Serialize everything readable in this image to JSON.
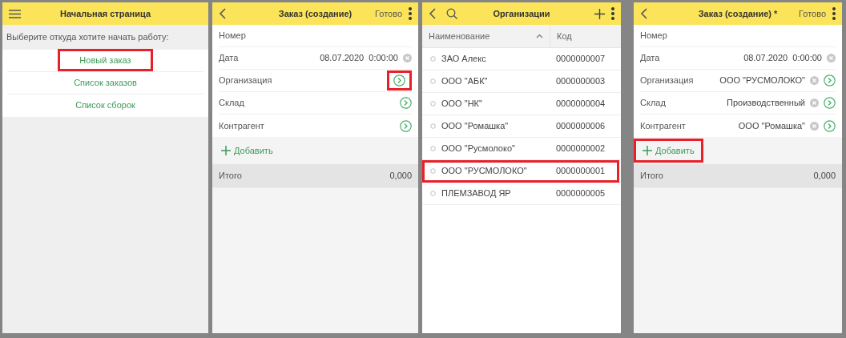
{
  "screens": [
    {
      "kind": "home",
      "title": "Начальная страница",
      "prompt": "Выберите откуда хотите начать работу:",
      "links": [
        {
          "label": "Новый заказ",
          "highlighted": true
        },
        {
          "label": "Список заказов",
          "highlighted": false
        },
        {
          "label": "Список сборок",
          "highlighted": false
        }
      ]
    },
    {
      "kind": "form",
      "title": "Заказ (создание)",
      "done": "Готово",
      "fields": [
        {
          "label": "Номер",
          "clear": false,
          "select": false,
          "highlighted": false
        },
        {
          "label": "Дата",
          "value": "08.07.2020  0:00:00",
          "clear": true,
          "select": false,
          "highlighted": false
        },
        {
          "label": "Организация",
          "clear": false,
          "select": true,
          "highlighted": true
        },
        {
          "label": "Склад",
          "clear": false,
          "select": true,
          "highlighted": false
        },
        {
          "label": "Контрагент",
          "clear": false,
          "select": true,
          "highlighted": false
        }
      ],
      "add": {
        "label": "Добавить",
        "highlighted": false
      },
      "total": {
        "label": "Итого",
        "value": "0,000"
      }
    },
    {
      "kind": "list",
      "title": "Организации",
      "columns": [
        {
          "label": "Наименование",
          "sorted": true
        },
        {
          "label": "Код",
          "sorted": false
        }
      ],
      "rows": [
        {
          "name": "ЗАО Алекс",
          "code": "0000000007",
          "highlighted": false
        },
        {
          "name": "ООО \"АБК\"",
          "code": "0000000003",
          "highlighted": false
        },
        {
          "name": "ООО \"НК\"",
          "code": "0000000004",
          "highlighted": false
        },
        {
          "name": "ООО \"Ромашка\"",
          "code": "0000000006",
          "highlighted": false
        },
        {
          "name": "ООО \"Русмолоко\"",
          "code": "0000000002",
          "highlighted": false
        },
        {
          "name": "ООО \"РУСМОЛОКО\"",
          "code": "0000000001",
          "highlighted": true
        },
        {
          "name": "ПЛЕМЗАВОД ЯР",
          "code": "0000000005",
          "highlighted": false
        }
      ]
    },
    {
      "kind": "form",
      "title": "Заказ (создание) *",
      "done": "Готово",
      "fields": [
        {
          "label": "Номер",
          "clear": false,
          "select": false,
          "highlighted": false
        },
        {
          "label": "Дата",
          "value": "08.07.2020  0:00:00",
          "clear": true,
          "select": false,
          "highlighted": false
        },
        {
          "label": "Организация",
          "value": "ООО \"РУСМОЛОКО\"",
          "clear": true,
          "select": true,
          "highlighted": false
        },
        {
          "label": "Склад",
          "value": "Производственный",
          "clear": true,
          "select": true,
          "highlighted": false
        },
        {
          "label": "Контрагент",
          "value": "ООО \"Ромашка\"",
          "clear": true,
          "select": true,
          "highlighted": false
        }
      ],
      "add": {
        "label": "Добавить",
        "highlighted": true
      },
      "total": {
        "label": "Итого",
        "value": "0,000"
      }
    }
  ]
}
